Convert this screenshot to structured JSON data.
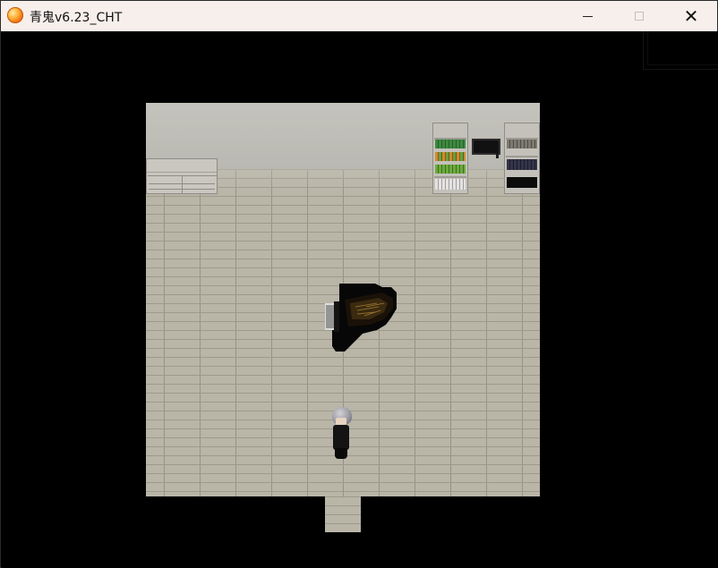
{
  "window": {
    "title": "青鬼v6.23_CHT",
    "icon": "ao-oni-orb-icon",
    "controls": {
      "minimize": "minimize-icon",
      "maximize": "maximize-icon",
      "close": "close-icon",
      "close_glyph": "✕"
    }
  },
  "scene": {
    "room": "piano-room",
    "objects": [
      "low-cabinet",
      "bookshelf-colored",
      "television",
      "bookshelf-dark",
      "grand-piano",
      "player-character"
    ],
    "colors": {
      "background": "#000000",
      "floor": "#b9b6a8",
      "wall": "#c4c3bc",
      "titlebar": "#f7efec"
    }
  }
}
